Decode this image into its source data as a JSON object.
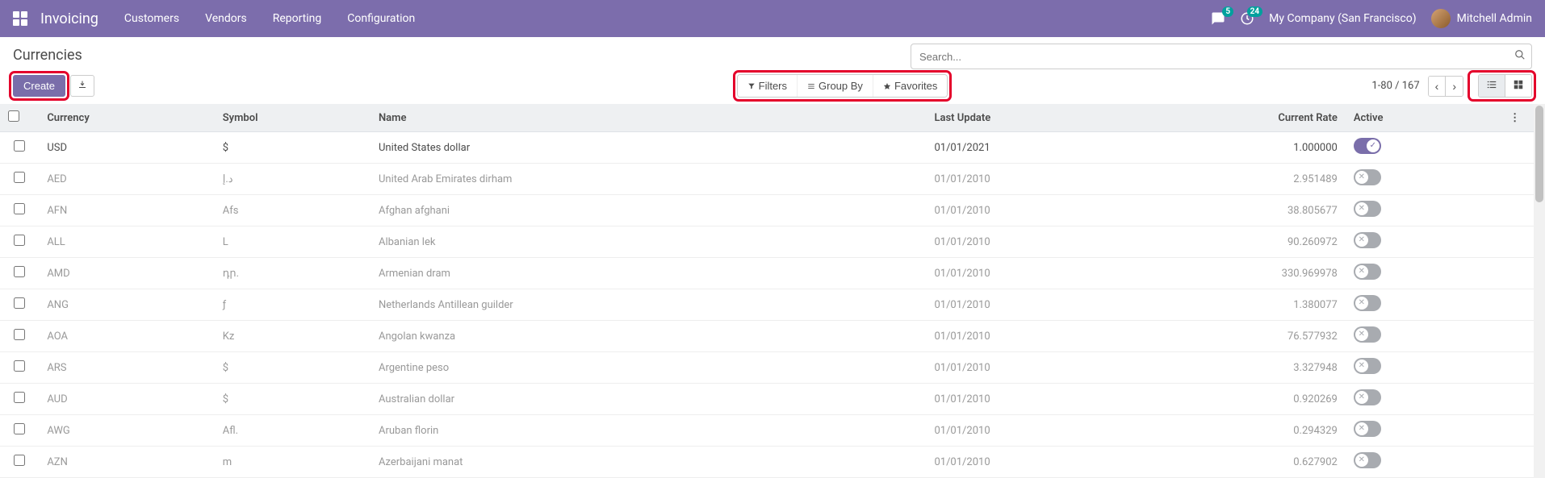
{
  "navbar": {
    "brand": "Invoicing",
    "menu": [
      "Customers",
      "Vendors",
      "Reporting",
      "Configuration"
    ],
    "chat_badge": "5",
    "activity_badge": "24",
    "company": "My Company (San Francisco)",
    "user": "Mitchell Admin"
  },
  "page": {
    "title": "Currencies",
    "create_label": "Create",
    "search_placeholder": "Search...",
    "filters_label": "Filters",
    "groupby_label": "Group By",
    "favorites_label": "Favorites",
    "pager": "1-80 / 167"
  },
  "columns": {
    "currency": "Currency",
    "symbol": "Symbol",
    "name": "Name",
    "last_update": "Last Update",
    "rate": "Current Rate",
    "active": "Active"
  },
  "rows": [
    {
      "code": "USD",
      "symbol": "$",
      "name": "United States dollar",
      "update": "01/01/2021",
      "rate": "1.000000",
      "active": true
    },
    {
      "code": "AED",
      "symbol": "د.إ",
      "name": "United Arab Emirates dirham",
      "update": "01/01/2010",
      "rate": "2.951489",
      "active": false
    },
    {
      "code": "AFN",
      "symbol": "Afs",
      "name": "Afghan afghani",
      "update": "01/01/2010",
      "rate": "38.805677",
      "active": false
    },
    {
      "code": "ALL",
      "symbol": "L",
      "name": "Albanian lek",
      "update": "01/01/2010",
      "rate": "90.260972",
      "active": false
    },
    {
      "code": "AMD",
      "symbol": "դր.",
      "name": "Armenian dram",
      "update": "01/01/2010",
      "rate": "330.969978",
      "active": false
    },
    {
      "code": "ANG",
      "symbol": "ƒ",
      "name": "Netherlands Antillean guilder",
      "update": "01/01/2010",
      "rate": "1.380077",
      "active": false
    },
    {
      "code": "AOA",
      "symbol": "Kz",
      "name": "Angolan kwanza",
      "update": "01/01/2010",
      "rate": "76.577932",
      "active": false
    },
    {
      "code": "ARS",
      "symbol": "$",
      "name": "Argentine peso",
      "update": "01/01/2010",
      "rate": "3.327948",
      "active": false
    },
    {
      "code": "AUD",
      "symbol": "$",
      "name": "Australian dollar",
      "update": "01/01/2010",
      "rate": "0.920269",
      "active": false
    },
    {
      "code": "AWG",
      "symbol": "Afl.",
      "name": "Aruban florin",
      "update": "01/01/2010",
      "rate": "0.294329",
      "active": false
    },
    {
      "code": "AZN",
      "symbol": "m",
      "name": "Azerbaijani manat",
      "update": "01/01/2010",
      "rate": "0.627902",
      "active": false
    }
  ]
}
